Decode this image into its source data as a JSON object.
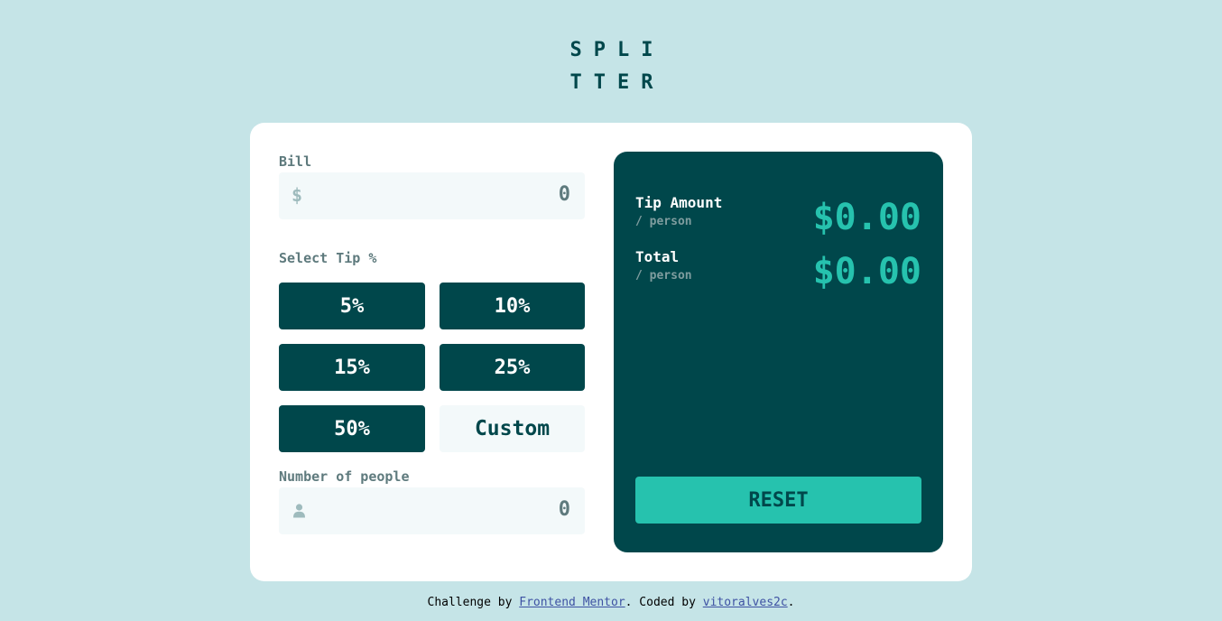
{
  "logo": {
    "line1": "SPLI",
    "line2": "TTER"
  },
  "bill": {
    "label": "Bill",
    "currency_symbol": "$",
    "placeholder": "0"
  },
  "tip": {
    "label": "Select Tip %",
    "options": [
      "5%",
      "10%",
      "15%",
      "25%",
      "50%"
    ],
    "custom_placeholder": "Custom"
  },
  "people": {
    "label": "Number of people",
    "placeholder": "0",
    "icon": "person-icon"
  },
  "results": {
    "tip_amount_label": "Tip Amount",
    "tip_amount_sub": "/ person",
    "tip_amount_value": "$0.00",
    "total_label": "Total",
    "total_sub": "/ person",
    "total_value": "$0.00",
    "reset_label": "RESET"
  },
  "attribution": {
    "prefix": "Challenge by ",
    "link1": "Frontend Mentor",
    "middle": ". Coded by ",
    "link2": "vitoralves2c",
    "suffix": "."
  },
  "colors": {
    "background": "#c5e4e7",
    "dark_cyan": "#00474b",
    "strong_cyan": "#26c2ae",
    "input_bg": "#f3f9fa"
  }
}
